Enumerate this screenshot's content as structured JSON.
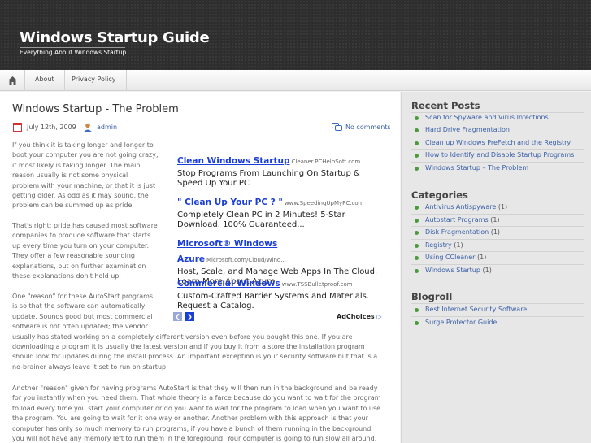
{
  "header": {
    "site_title": "Windows Startup Guide",
    "tagline": "Everything About Windows Startup"
  },
  "nav": {
    "home_icon": "home-icon",
    "items": [
      {
        "label": "About"
      },
      {
        "label": "Privacy Policy"
      }
    ]
  },
  "post": {
    "title": "Windows Startup - The Problem",
    "date": "July 12th, 2009",
    "author": "admin",
    "comments": "No comments",
    "paragraphs": [
      [
        "If you think it is taking longer and longer to",
        "boot your computer you are not going crazy,",
        "it most likely is taking longer. The main",
        "reason usually is not some physical",
        "problem with your machine, or that it is just",
        "getting older. As odd as it may sound, the",
        "problem can be summed up as pride."
      ],
      [
        "That's right; pride has caused most software",
        "companies to produce software that starts",
        "up every time you turn on your computer.",
        "They offer a few reasonable sounding",
        "explanations, but on further examination",
        "these explanations don't hold up."
      ],
      [
        "One \"reason\" for these AutoStart programs",
        "is so that the software can automatically",
        "update. Sounds good but most commercial",
        "software is not often updated; the vendor",
        "usually has stated working on a completely different version even before you bought this one. If you are",
        "downloading a program it is usually the latest version and if you buy it from a store the installation program",
        "should look for updates during the install process. An important exception is your security software but that is a",
        "no-brainer always leave it set to run on startup."
      ],
      [
        "Another \"reason\" given for having programs AutoStart is that they will then run in the background and be ready",
        "for you instantly when you need them. That whole theory is a farce because do you want to wait for the program",
        "to load every time you start your computer or do you want to wait for the program to load when you want to use",
        "the program. You are going to wait for it one way or another. Another problem with this approach is that your",
        "computer has only so much memory to run programs, if you have a bunch of them running in the background",
        "you will not have any memory left to run them in the foreground. Your computer is going to run slow all around."
      ]
    ]
  },
  "ads": {
    "items": [
      {
        "title": "Clean Windows Startup",
        "url": "Cleaner.PCHelpSoft.com",
        "desc": [
          "Stop Programs From Launching On Startup &",
          "Speed Up Your PC"
        ]
      },
      {
        "title": "\" Clean Up Your PC ? \"",
        "url": "www.SpeedingUpMyPC.com",
        "desc": [
          "Completely Clean PC in 2 Minutes! 5-Star",
          "Download. 100% Guaranteed..."
        ]
      },
      {
        "title": "Microsoft® Windows Azure",
        "url": "Microsoft.com/Cloud/Wind...",
        "desc": [
          "Host, Scale, and Manage Web Apps In The Cloud.",
          "Learn More About Azure."
        ]
      },
      {
        "title": "Commercial Windows",
        "url": "www.TSSBulletproof.com",
        "desc": [
          "Custom-Crafted Barrier Systems and Materials.",
          "Request a Catalog."
        ]
      }
    ],
    "prev_icon": "chevron-left-icon",
    "next_icon": "chevron-right-icon",
    "adchoices": "AdChoices"
  },
  "sidebar": {
    "recent_posts": {
      "heading": "Recent Posts",
      "items": [
        {
          "label": "Scan for Spyware and Virus Infections"
        },
        {
          "label": "Hard Drive Fragmentation"
        },
        {
          "label": "Clean up Windows PreFetch and the Registry"
        },
        {
          "label": "How to Identify and Disable Startup Programs"
        },
        {
          "label": "Windows Startup – The Problem"
        }
      ]
    },
    "categories": {
      "heading": "Categories",
      "items": [
        {
          "label": "Antivirus Antispyware",
          "count": "(1)"
        },
        {
          "label": "Autostart Programs",
          "count": "(1)"
        },
        {
          "label": "Disk Fragmentation",
          "count": "(1)"
        },
        {
          "label": "Registry",
          "count": "(1)"
        },
        {
          "label": "Using CCleaner",
          "count": "(1)"
        },
        {
          "label": "Windows Startup",
          "count": "(1)"
        }
      ]
    },
    "blogroll": {
      "heading": "Blogroll",
      "items": [
        {
          "label": "Best Internet Security Software"
        },
        {
          "label": "Surge Protector Guide"
        }
      ]
    }
  },
  "colors": {
    "header_bg": "#2e2e2e",
    "link": "#3a5fa8",
    "ad_link": "#1a3ed8",
    "bullet": "#4a9c3a",
    "sidebar_bg": "#e7e7e7"
  }
}
